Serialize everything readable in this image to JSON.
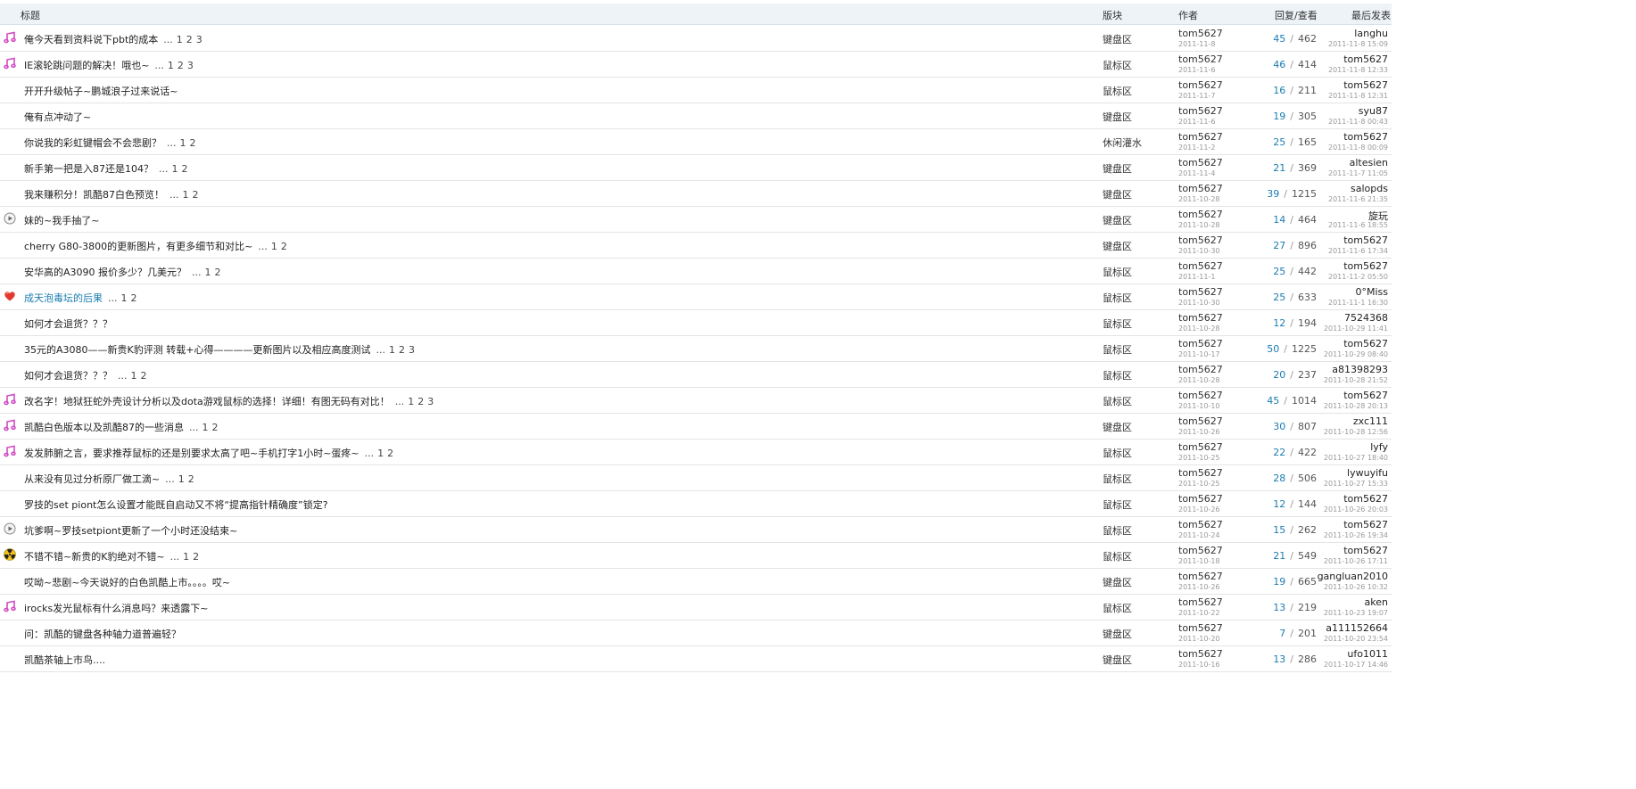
{
  "header": {
    "title": "标题",
    "forum": "版块",
    "author": "作者",
    "stats": "回复/查看",
    "last_post": "最后发表"
  },
  "pager_dots": "...",
  "stats_sep": "/",
  "colors": {
    "link_blue": "#1a7cb0",
    "header_bg": "#eef3f7",
    "music_icon": "#d24bc4"
  },
  "threads": [
    {
      "icon": "music-icon",
      "title": "俺今天看到资料说下pbt的成本",
      "pages": [
        "1",
        "2",
        "3"
      ],
      "forum": "键盘区",
      "author": "tom5627",
      "author_date": "2011-11-8",
      "replies": "45",
      "views": "462",
      "last_user": "langhu",
      "last_date": "2011-11-8 15:09"
    },
    {
      "icon": "music-icon",
      "title": "IE滚轮跳问题的解决！哦也~",
      "pages": [
        "1",
        "2",
        "3"
      ],
      "forum": "鼠标区",
      "author": "tom5627",
      "author_date": "2011-11-6",
      "replies": "46",
      "views": "414",
      "last_user": "tom5627",
      "last_date": "2011-11-8 12:33"
    },
    {
      "icon": "",
      "title": "开开升级帖子~鹏城浪子过来说话~",
      "pages": [],
      "forum": "鼠标区",
      "author": "tom5627",
      "author_date": "2011-11-7",
      "replies": "16",
      "views": "211",
      "last_user": "tom5627",
      "last_date": "2011-11-8 12:31"
    },
    {
      "icon": "",
      "title": "俺有点冲动了~",
      "pages": [],
      "forum": "键盘区",
      "author": "tom5627",
      "author_date": "2011-11-6",
      "replies": "19",
      "views": "305",
      "last_user": "syu87",
      "last_date": "2011-11-8 00:43"
    },
    {
      "icon": "",
      "title": "你说我的彩虹键帽会不会悲剧？",
      "pages": [
        "1",
        "2"
      ],
      "forum": "休闲灌水",
      "author": "tom5627",
      "author_date": "2011-11-2",
      "replies": "25",
      "views": "165",
      "last_user": "tom5627",
      "last_date": "2011-11-8 00:09"
    },
    {
      "icon": "",
      "title": "新手第一把是入87还是104？",
      "pages": [
        "1",
        "2"
      ],
      "forum": "键盘区",
      "author": "tom5627",
      "author_date": "2011-11-4",
      "replies": "21",
      "views": "369",
      "last_user": "altesien",
      "last_date": "2011-11-7 11:05"
    },
    {
      "icon": "",
      "title": "我来赚积分！凯酷87白色预览！",
      "pages": [
        "1",
        "2"
      ],
      "forum": "键盘区",
      "author": "tom5627",
      "author_date": "2011-10-28",
      "replies": "39",
      "views": "1215",
      "last_user": "salopds",
      "last_date": "2011-11-6 21:35"
    },
    {
      "icon": "play-icon",
      "title": "妹的~我手抽了~",
      "pages": [],
      "forum": "键盘区",
      "author": "tom5627",
      "author_date": "2011-10-28",
      "replies": "14",
      "views": "464",
      "last_user": "旋玩",
      "last_date": "2011-11-6 18:55"
    },
    {
      "icon": "",
      "title": "cherry G80-3800的更新图片，有更多细节和对比~",
      "pages": [
        "1",
        "2"
      ],
      "forum": "键盘区",
      "author": "tom5627",
      "author_date": "2011-10-30",
      "replies": "27",
      "views": "896",
      "last_user": "tom5627",
      "last_date": "2011-11-6 17:34"
    },
    {
      "icon": "",
      "title": "安华高的A3090 报价多少？几美元？",
      "pages": [
        "1",
        "2"
      ],
      "forum": "鼠标区",
      "author": "tom5627",
      "author_date": "2011-11-1",
      "replies": "25",
      "views": "442",
      "last_user": "tom5627",
      "last_date": "2011-11-2 05:50"
    },
    {
      "icon": "heart-icon",
      "title": "成天泡毒坛的后果",
      "pages": [
        "1",
        "2"
      ],
      "highlight": true,
      "forum": "鼠标区",
      "author": "tom5627",
      "author_date": "2011-10-30",
      "replies": "25",
      "views": "633",
      "last_user": "0°Miss",
      "last_date": "2011-11-1 16:30"
    },
    {
      "icon": "",
      "title": "如何才会退货？？？",
      "pages": [],
      "forum": "鼠标区",
      "author": "tom5627",
      "author_date": "2011-10-28",
      "replies": "12",
      "views": "194",
      "last_user": "7524368",
      "last_date": "2011-10-29 11:41"
    },
    {
      "icon": "",
      "title": "35元的A3080——新贵K豹评测 转载+心得————更新图片以及相应高度测试",
      "pages": [
        "1",
        "2",
        "3"
      ],
      "forum": "鼠标区",
      "author": "tom5627",
      "author_date": "2011-10-17",
      "replies": "50",
      "views": "1225",
      "last_user": "tom5627",
      "last_date": "2011-10-29 08:40"
    },
    {
      "icon": "",
      "title": "如何才会退货？？？",
      "pages": [
        "1",
        "2"
      ],
      "forum": "鼠标区",
      "author": "tom5627",
      "author_date": "2011-10-28",
      "replies": "20",
      "views": "237",
      "last_user": "a81398293",
      "last_date": "2011-10-28 21:52"
    },
    {
      "icon": "music-icon",
      "title": "改名字！地狱狂蛇外壳设计分析以及dota游戏鼠标的选择！详细！有图无码有对比！",
      "pages": [
        "1",
        "2",
        "3"
      ],
      "forum": "鼠标区",
      "author": "tom5627",
      "author_date": "2011-10-10",
      "replies": "45",
      "views": "1014",
      "last_user": "tom5627",
      "last_date": "2011-10-28 20:13"
    },
    {
      "icon": "music-icon",
      "title": "凯酷白色版本以及凯酷87的一些消息",
      "pages": [
        "1",
        "2"
      ],
      "forum": "键盘区",
      "author": "tom5627",
      "author_date": "2011-10-26",
      "replies": "30",
      "views": "807",
      "last_user": "zxc111",
      "last_date": "2011-10-28 12:56"
    },
    {
      "icon": "music-icon",
      "title": "发发肺腑之言，要求推荐鼠标的还是别要求太高了吧~手机打字1小时~蛋疼~",
      "pages": [
        "1",
        "2"
      ],
      "forum": "鼠标区",
      "author": "tom5627",
      "author_date": "2011-10-25",
      "replies": "22",
      "views": "422",
      "last_user": "lyfy",
      "last_date": "2011-10-27 18:40"
    },
    {
      "icon": "",
      "title": "从来没有见过分析原厂做工滴~",
      "pages": [
        "1",
        "2"
      ],
      "forum": "鼠标区",
      "author": "tom5627",
      "author_date": "2011-10-25",
      "replies": "28",
      "views": "506",
      "last_user": "lywuyifu",
      "last_date": "2011-10-27 15:33"
    },
    {
      "icon": "",
      "title": "罗技的set piont怎么设置才能既自启动又不将“提高指针精确度”锁定?",
      "pages": [],
      "forum": "鼠标区",
      "author": "tom5627",
      "author_date": "2011-10-26",
      "replies": "12",
      "views": "144",
      "last_user": "tom5627",
      "last_date": "2011-10-26 20:03"
    },
    {
      "icon": "play-icon",
      "title": "坑爹啊~罗技setpiont更新了一个小时还没结束~",
      "pages": [],
      "forum": "鼠标区",
      "author": "tom5627",
      "author_date": "2011-10-24",
      "replies": "15",
      "views": "262",
      "last_user": "tom5627",
      "last_date": "2011-10-26 19:34"
    },
    {
      "icon": "radiation-icon",
      "title": "不错不错~新贵的K豹绝对不错~",
      "pages": [
        "1",
        "2"
      ],
      "forum": "鼠标区",
      "author": "tom5627",
      "author_date": "2011-10-18",
      "replies": "21",
      "views": "549",
      "last_user": "tom5627",
      "last_date": "2011-10-26 17:11"
    },
    {
      "icon": "",
      "title": "哎呦~悲剧~今天说好的白色凯酷上市。。。。哎~",
      "pages": [],
      "forum": "键盘区",
      "author": "tom5627",
      "author_date": "2011-10-26",
      "replies": "19",
      "views": "665",
      "last_user": "gangluan2010",
      "last_date": "2011-10-26 10:32"
    },
    {
      "icon": "music-icon",
      "title": "irocks发光鼠标有什么消息吗？来透露下~",
      "pages": [],
      "forum": "鼠标区",
      "author": "tom5627",
      "author_date": "2011-10-22",
      "replies": "13",
      "views": "219",
      "last_user": "aken",
      "last_date": "2011-10-23 19:07"
    },
    {
      "icon": "",
      "title": "问：凯酷的键盘各种轴力道普遍轻？",
      "pages": [],
      "forum": "键盘区",
      "author": "tom5627",
      "author_date": "2011-10-20",
      "replies": "7",
      "views": "201",
      "last_user": "a111152664",
      "last_date": "2011-10-20 23:54"
    },
    {
      "icon": "",
      "title": "凯酷茶轴上市鸟....",
      "pages": [],
      "forum": "键盘区",
      "author": "tom5627",
      "author_date": "2011-10-16",
      "replies": "13",
      "views": "286",
      "last_user": "ufo1011",
      "last_date": "2011-10-17 14:46"
    }
  ]
}
